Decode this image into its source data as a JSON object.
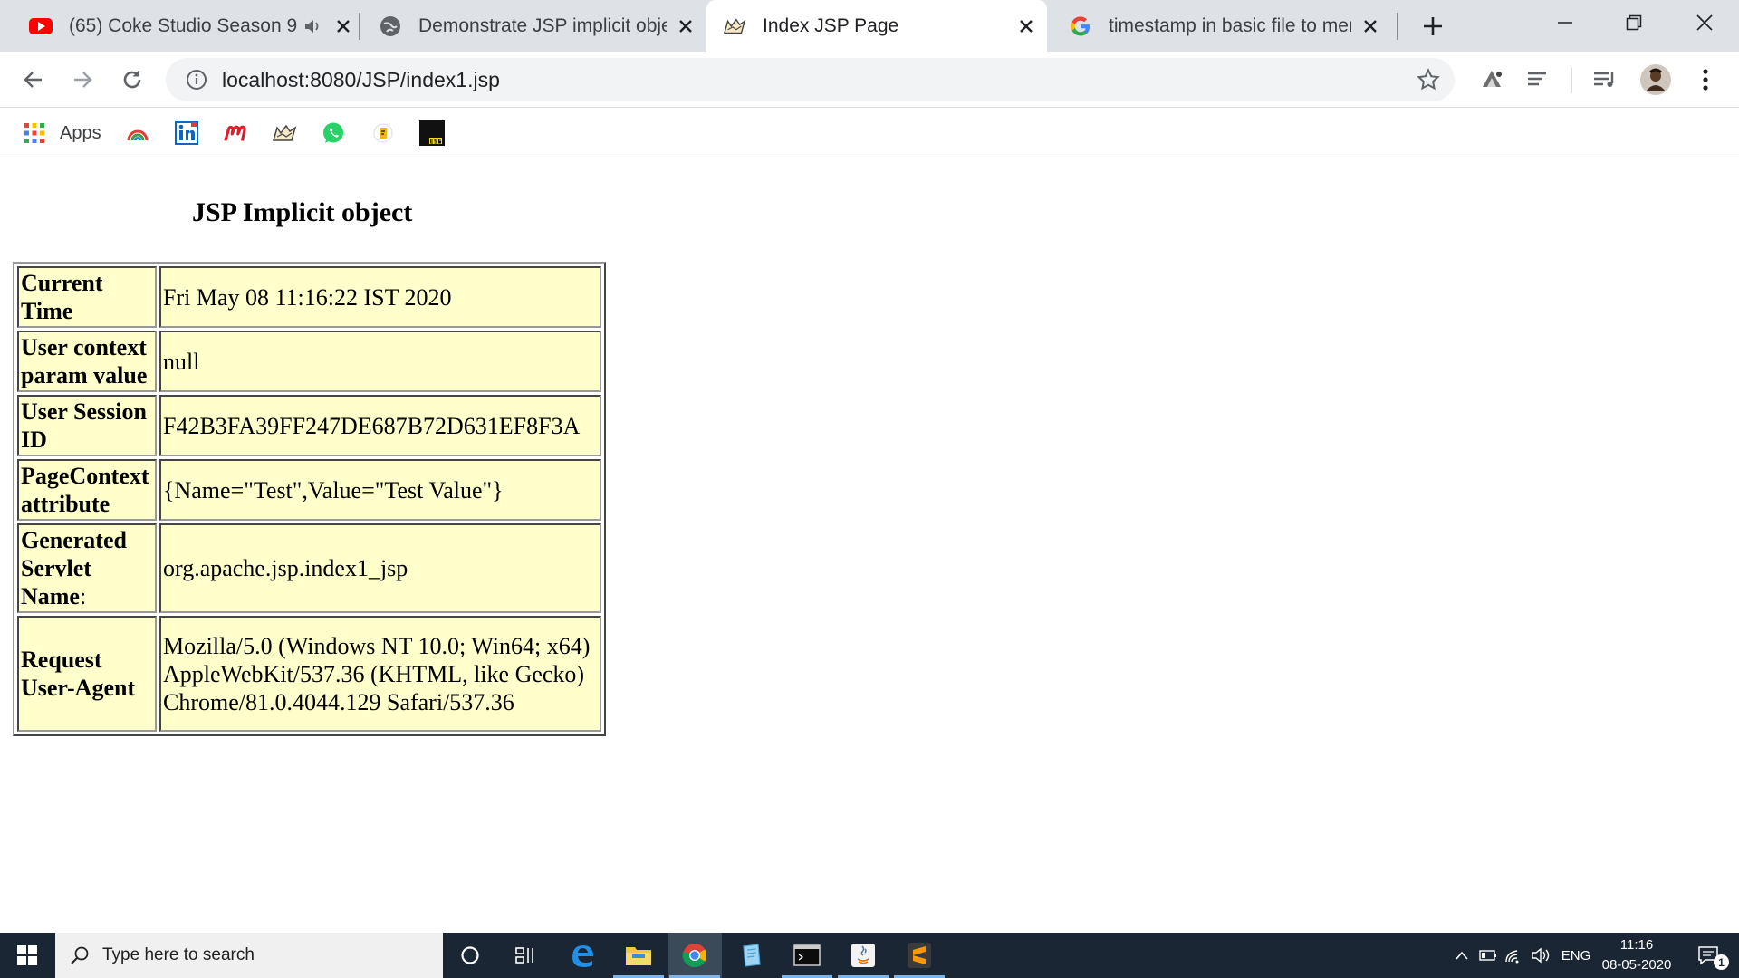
{
  "tabs": [
    {
      "title": "(65) Coke Studio Season 9",
      "favicon": "youtube-icon",
      "audio": true
    },
    {
      "title": "Demonstrate JSP implicit objec",
      "favicon": "globe-icon"
    },
    {
      "title": "Index JSP Page",
      "favicon": "tomcat-icon",
      "active": true
    },
    {
      "title": "timestamp in basic file to merc",
      "favicon": "google-icon"
    }
  ],
  "address_bar": {
    "url": "localhost:8080/JSP/index1.jsp"
  },
  "bookmarks": {
    "apps_label": "Apps"
  },
  "page": {
    "title": "JSP Implicit object",
    "rows": [
      {
        "label": "Current Time",
        "value": "Fri May 08 11:16:22 IST 2020"
      },
      {
        "label": "User context param value",
        "value": "null"
      },
      {
        "label": "User Session ID",
        "value": "F42B3FA39FF247DE687B72D631EF8F3A"
      },
      {
        "label": "PageContext attribute",
        "value": "{Name=\"Test\",Value=\"Test Value\"}"
      },
      {
        "label": "Generated Servlet Name",
        "label_suffix": ":",
        "value": "org.apache.jsp.index1_jsp"
      },
      {
        "label": "Request User-Agent",
        "value": "Mozilla/5.0 (Windows NT 10.0; Win64; x64) AppleWebKit/537.36 (KHTML, like Gecko) Chrome/81.0.4044.129 Safari/537.36"
      }
    ]
  },
  "taskbar": {
    "search_placeholder": "Type here to search",
    "language": "ENG",
    "time": "11:16",
    "date": "08-05-2020",
    "notification_count": "1"
  },
  "colors": {
    "table_cell_bg": "#ffffcc",
    "tabstrip_bg": "#dee1e6",
    "taskbar_bg": "#1a2633"
  }
}
